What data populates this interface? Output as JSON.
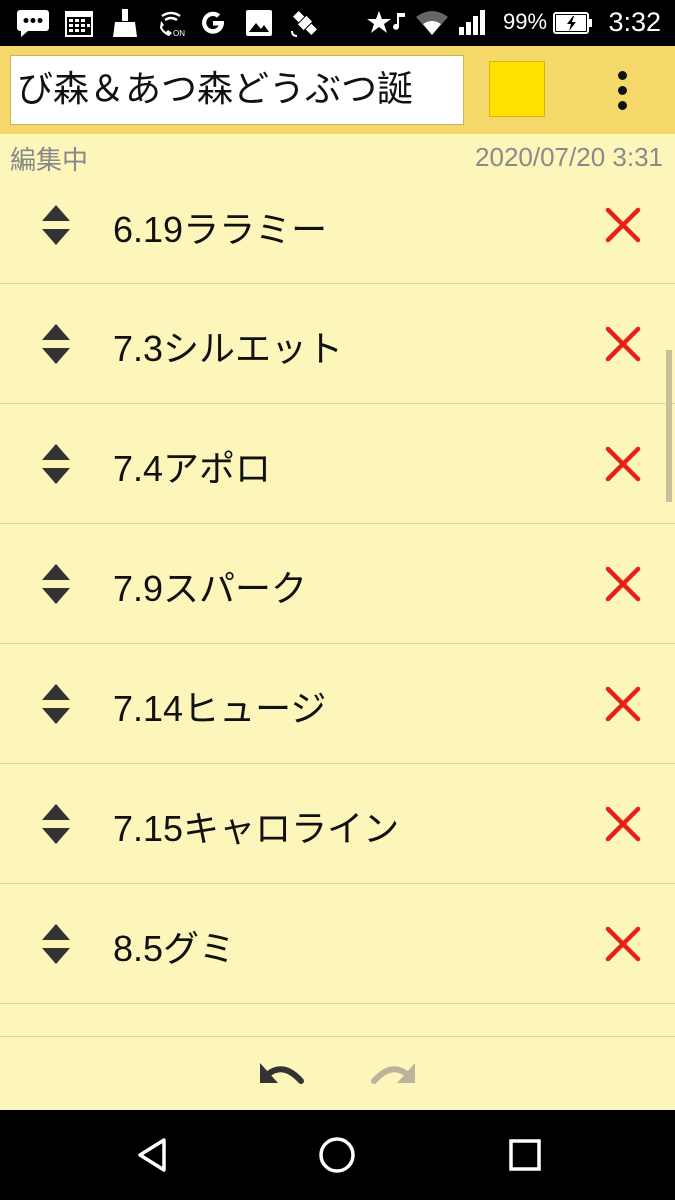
{
  "status_bar": {
    "battery_text": "99%",
    "time": "3:32",
    "icons": [
      "chat-icon",
      "calendar-icon",
      "cleaner-icon",
      "wifi-calling-icon",
      "google-icon",
      "image-icon",
      "satellite-icon",
      "star-music-icon",
      "wifi-icon",
      "signal-icon",
      "battery-charging-icon"
    ]
  },
  "toolbar": {
    "title_value": "び森＆あつ森どうぶつ誕",
    "swatch_color": "#ffe100",
    "menu_icon": "more-vert-icon"
  },
  "info": {
    "edit_status": "編集中",
    "timestamp": "2020/07/20 3:31"
  },
  "items": [
    {
      "num": "6.19",
      "name": "ララミー"
    },
    {
      "num": "7.3",
      "name": "シルエット"
    },
    {
      "num": "7.4",
      "name": "アポロ"
    },
    {
      "num": "7.9",
      "name": "スパーク"
    },
    {
      "num": "7.14",
      "name": "ヒュージ"
    },
    {
      "num": "7.15",
      "name": "キャロライン"
    },
    {
      "num": "8.5",
      "name": "グミ"
    }
  ],
  "actions": {
    "undo_icon": "undo-icon",
    "redo_icon": "redo-icon",
    "redo_enabled": false
  },
  "colors": {
    "background": "#fdf6ba",
    "toolbar": "#f4d96a",
    "delete": "#e8201c",
    "divider": "#e6d98c"
  }
}
